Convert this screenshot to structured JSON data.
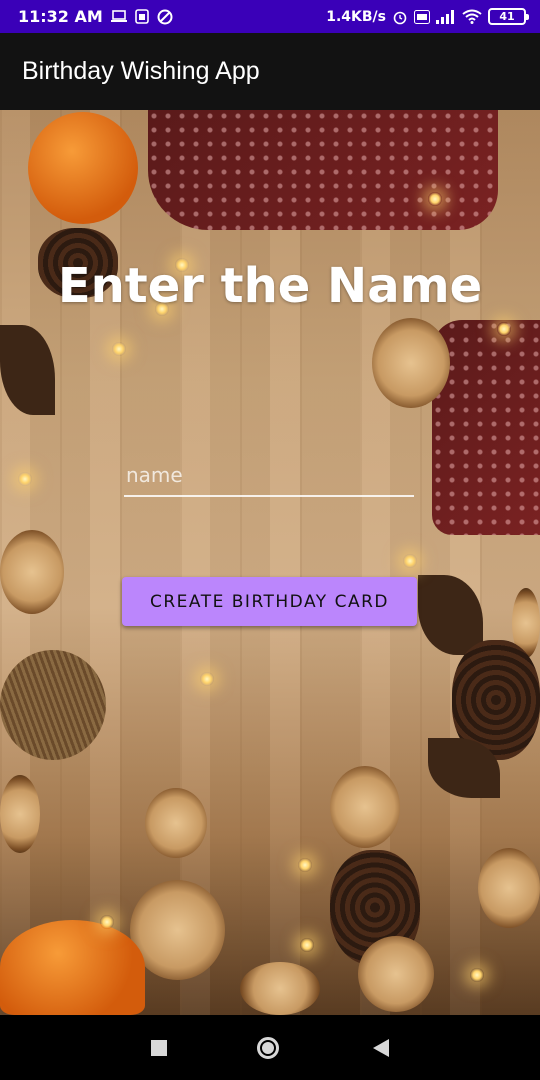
{
  "status_bar": {
    "time": "11:32 AM",
    "network_speed": "1.4KB/s",
    "battery": "41",
    "icons": [
      "laptop-icon",
      "sim-icon",
      "dnd-icon",
      "alarm-icon",
      "volte-icon",
      "signal-icon",
      "wifi-icon",
      "battery-icon"
    ]
  },
  "app_bar": {
    "title": "Birthday Wishing App"
  },
  "main": {
    "heading": "Enter the Name",
    "name_input": {
      "placeholder": "name",
      "value": ""
    },
    "create_button_label": "CREATE BIRTHDAY CARD",
    "background": "wooden-table-with-birthday-decorations"
  },
  "nav_bar": {
    "buttons": [
      "recents-button",
      "home-button",
      "back-button"
    ]
  },
  "colors": {
    "status_bar": "#3a00b8",
    "app_bar": "#121212",
    "button": "#bb86fc",
    "heading_text": "#ffffff"
  }
}
